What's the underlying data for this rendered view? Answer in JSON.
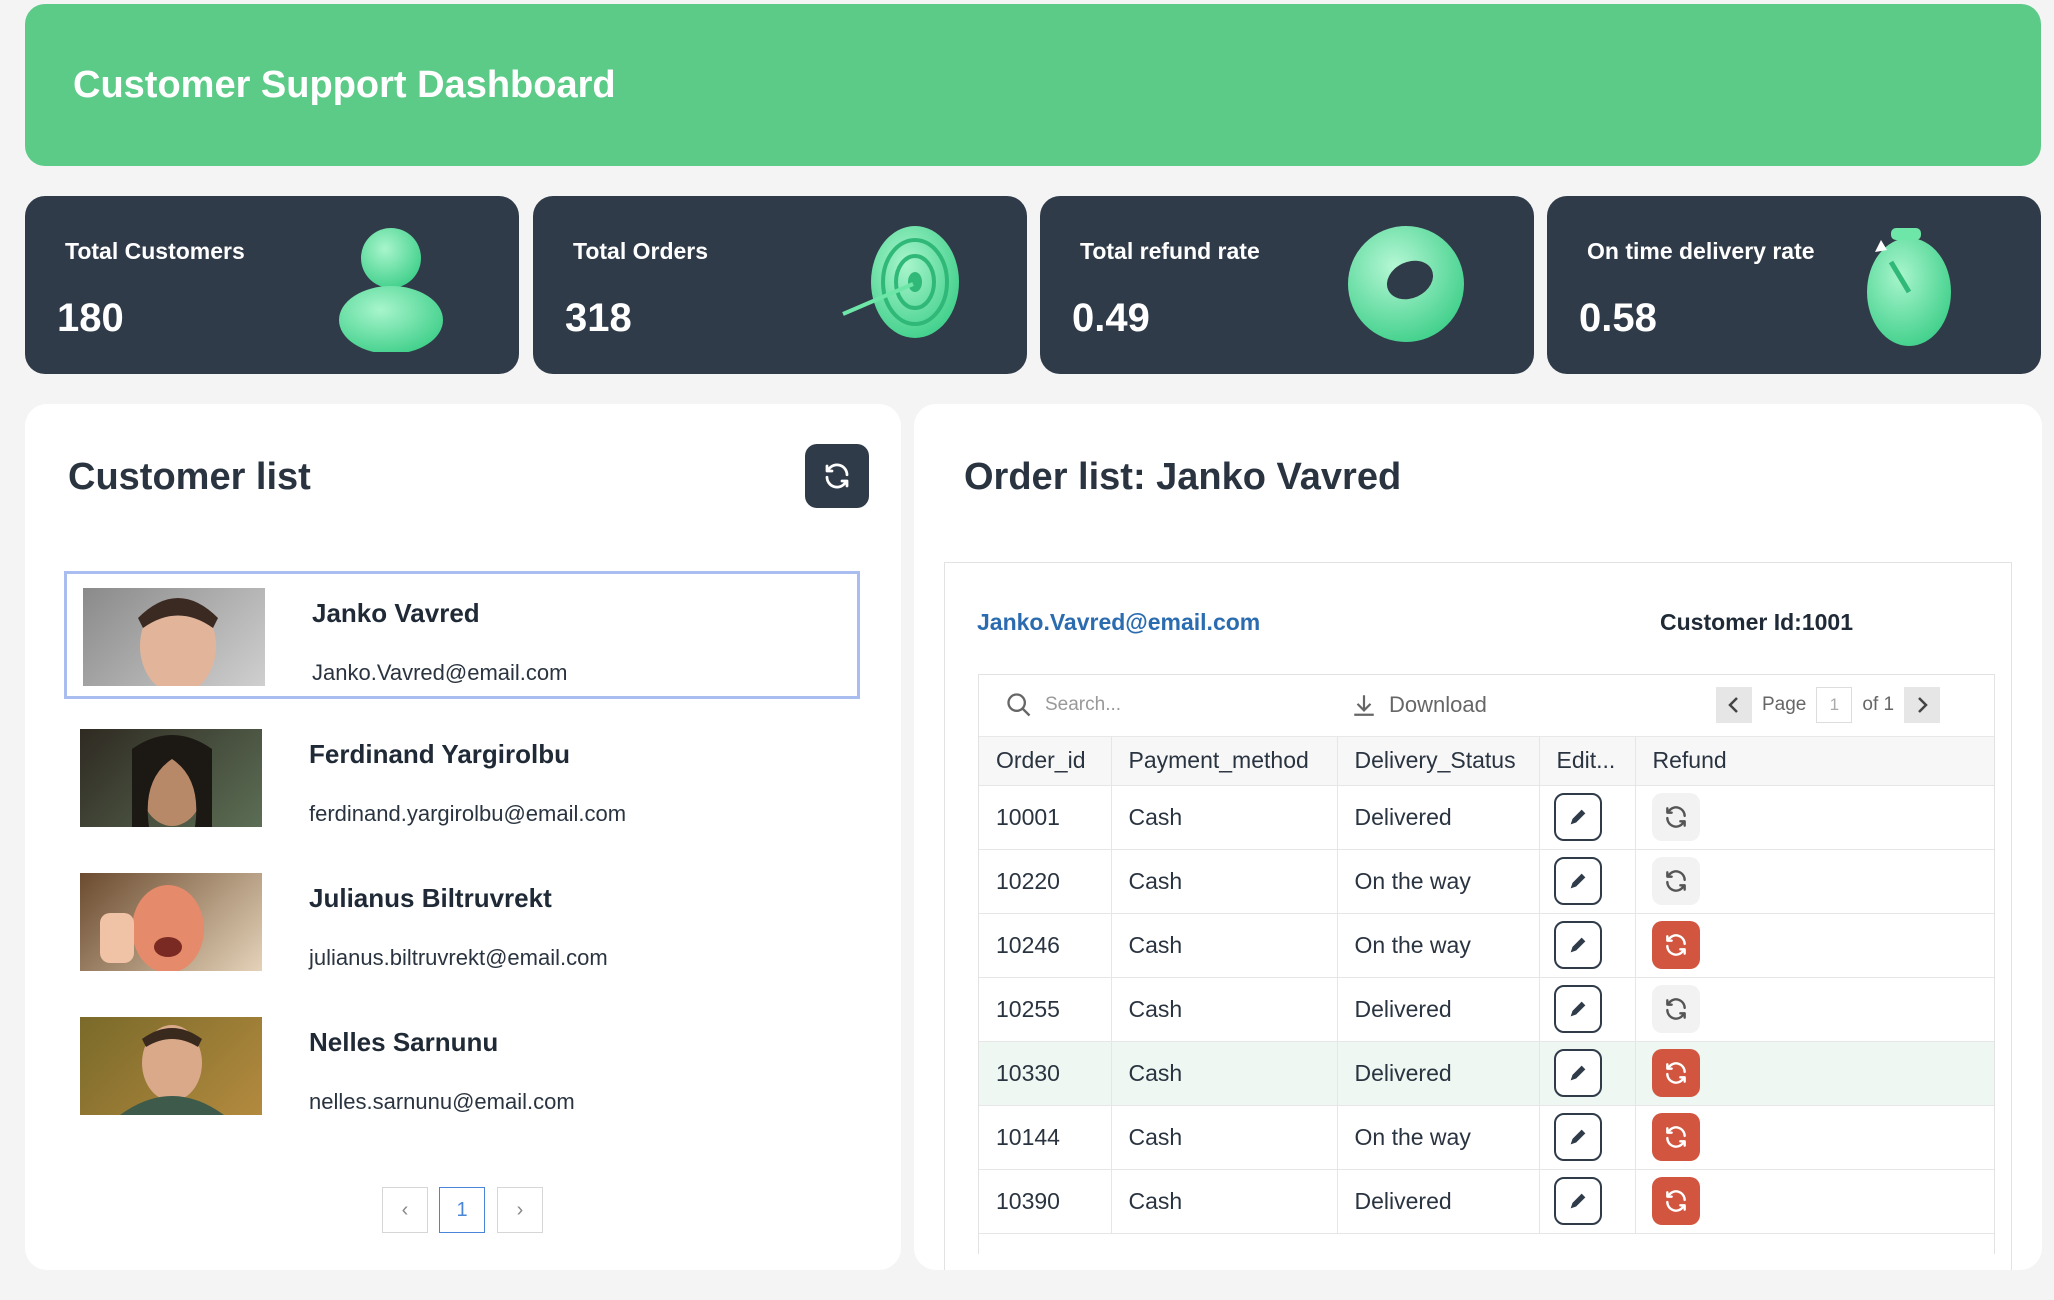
{
  "header": {
    "title": "Customer Support Dashboard",
    "bg": "#5dcb88"
  },
  "stats": [
    {
      "label": "Total Customers",
      "value": "180",
      "icon": "person-icon"
    },
    {
      "label": "Total Orders",
      "value": "318",
      "icon": "target-icon"
    },
    {
      "label": "Total refund rate",
      "value": "0.49",
      "icon": "lifebuoy-icon"
    },
    {
      "label": "On time delivery rate",
      "value": "0.58",
      "icon": "stopwatch-icon"
    }
  ],
  "customer_list": {
    "title": "Customer list",
    "refresh_icon": "refresh-icon",
    "customers": [
      {
        "name": "Janko Vavred",
        "email": "Janko.Vavred@email.com",
        "selected": true
      },
      {
        "name": "Ferdinand Yargirolbu",
        "email": "ferdinand.yargirolbu@email.com",
        "selected": false
      },
      {
        "name": "Julianus Biltruvrekt",
        "email": "julianus.biltruvrekt@email.com",
        "selected": false
      },
      {
        "name": "Nelles Sarnunu",
        "email": "nelles.sarnunu@email.com",
        "selected": false
      }
    ],
    "pagination": {
      "prev": "‹",
      "current": "1",
      "next": "›"
    }
  },
  "order_list": {
    "title": "Order list: Janko Vavred",
    "email": "Janko.Vavred@email.com",
    "customer_id": "Customer Id:1001",
    "toolbar": {
      "search_placeholder": "Search...",
      "download_label": "Download",
      "page_label": "Page",
      "page_value": "1",
      "page_of": "of 1"
    },
    "columns": [
      "Order_id",
      "Payment_method",
      "Delivery_Status",
      "Edit...",
      "Refund"
    ],
    "rows": [
      {
        "order_id": "10001",
        "payment": "Cash",
        "status": "Delivered",
        "refunded": false
      },
      {
        "order_id": "10220",
        "payment": "Cash",
        "status": "On the way",
        "refunded": false
      },
      {
        "order_id": "10246",
        "payment": "Cash",
        "status": "On the way",
        "refunded": true
      },
      {
        "order_id": "10255",
        "payment": "Cash",
        "status": "Delivered",
        "refunded": false
      },
      {
        "order_id": "10330",
        "payment": "Cash",
        "status": "Delivered",
        "refunded": true
      },
      {
        "order_id": "10144",
        "payment": "Cash",
        "status": "On the way",
        "refunded": true
      },
      {
        "order_id": "10390",
        "payment": "Cash",
        "status": "Delivered",
        "refunded": true
      }
    ],
    "accent_refund": "#d2553f",
    "highlight_row": "10330"
  }
}
